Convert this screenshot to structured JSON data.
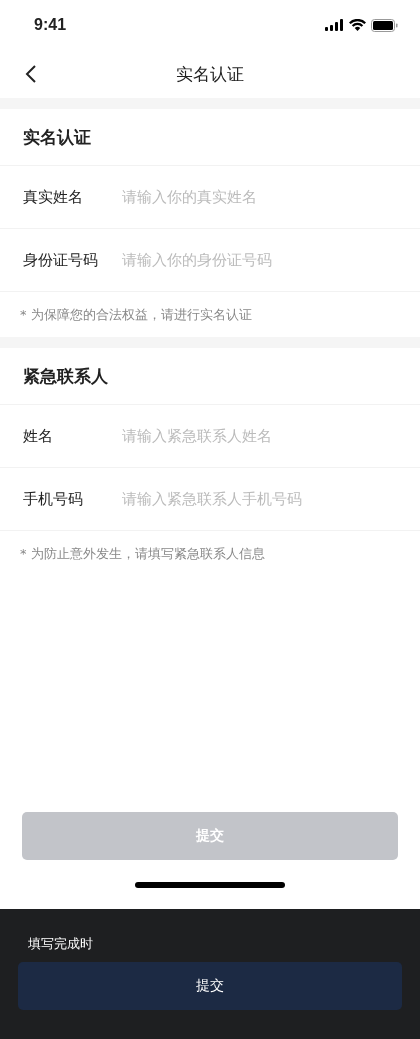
{
  "status_bar": {
    "time": "9:41"
  },
  "nav": {
    "title": "实名认证"
  },
  "sections": [
    {
      "title": "实名认证",
      "fields": [
        {
          "label": "真实姓名",
          "placeholder": "请输入你的真实姓名"
        },
        {
          "label": "身份证号码",
          "placeholder": "请输入你的身份证号码"
        }
      ],
      "note": "* 为保障您的合法权益，请进行实名认证"
    },
    {
      "title": "紧急联系人",
      "fields": [
        {
          "label": "姓名",
          "placeholder": "请输入紧急联系人姓名"
        },
        {
          "label": "手机号码",
          "placeholder": "请输入紧急联系人手机号码"
        }
      ],
      "note": "* 为防止意外发生，请填写紧急联系人信息"
    }
  ],
  "submit_button": {
    "label": "提交",
    "disabled": true
  },
  "completed_panel": {
    "caption": "填写完成时",
    "button": {
      "label": "提交",
      "disabled": false
    }
  }
}
